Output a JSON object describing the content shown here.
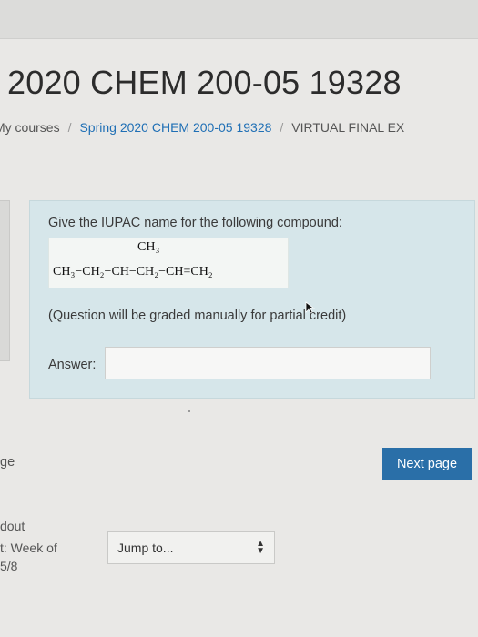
{
  "page": {
    "title": "2020 CHEM 200-05 19328"
  },
  "breadcrumb": {
    "items": [
      "My courses",
      "Spring 2020 CHEM 200-05 19328",
      "VIRTUAL FINAL EX"
    ],
    "separator": "/"
  },
  "question": {
    "prompt": "Give the IUPAC name for the following compound:",
    "formula_branch": "CH₃",
    "formula_chain": "CH₃−CH₂−CH−CH₂−CH=CH₂",
    "note": "(Question will be graded manually for partial credit)",
    "answer_label": "Answer:",
    "answer_value": ""
  },
  "navigation": {
    "previous_label": "ge",
    "next_label": "Next page",
    "handout_label": "dout",
    "week_label": "t: Week of",
    "date_label": "5/8",
    "jump_label": "Jump to..."
  },
  "colors": {
    "accent": "#2a6fa8",
    "question_bg": "#d6e6ea",
    "link": "#1f6fb5"
  }
}
